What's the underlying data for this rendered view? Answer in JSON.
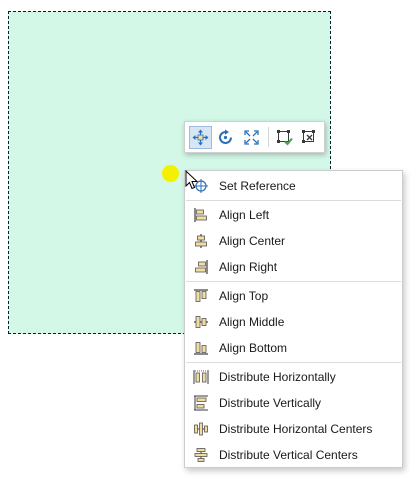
{
  "toolbar": {
    "buttons": [
      {
        "icon": "move-icon",
        "active": true
      },
      {
        "icon": "rotate-icon",
        "active": false
      },
      {
        "icon": "resize-icon",
        "active": false
      },
      {
        "icon": "apply-edits-icon",
        "active": false
      },
      {
        "icon": "cancel-edits-icon",
        "active": false
      }
    ]
  },
  "menu": {
    "set_reference": "Set Reference",
    "align_left": "Align Left",
    "align_center": "Align Center",
    "align_right": "Align Right",
    "align_top": "Align Top",
    "align_middle": "Align Middle",
    "align_bottom": "Align Bottom",
    "distribute_horizontally": "Distribute Horizontally",
    "distribute_vertically": "Distribute Vertically",
    "distribute_horizontal_centers": "Distribute Horizontal Centers",
    "distribute_vertical_centers": "Distribute Vertical Centers"
  },
  "colors": {
    "shape_fill": "#d3f8e8",
    "icon_blue": "#2a6fb8",
    "icon_tan": "#f2dca0",
    "icon_green": "#3aa84a",
    "highlight": "#f3f000"
  }
}
